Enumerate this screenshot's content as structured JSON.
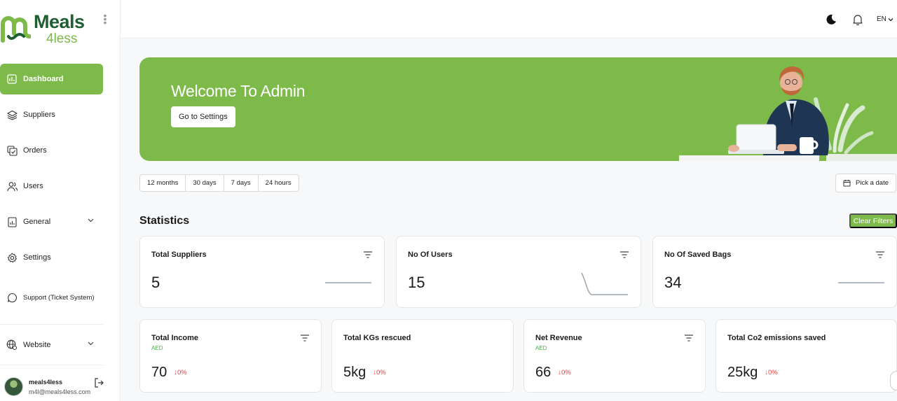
{
  "brand": {
    "line1": "Meals",
    "line2": "4less"
  },
  "sidebar": {
    "items": [
      {
        "label": "Dashboard",
        "icon": "dashboard-icon",
        "active": true
      },
      {
        "label": "Suppliers",
        "icon": "layers-icon"
      },
      {
        "label": "Orders",
        "icon": "orders-icon"
      },
      {
        "label": "Users",
        "icon": "users-icon"
      },
      {
        "label": "General",
        "icon": "report-icon"
      },
      {
        "label": "Settings",
        "icon": "gear-icon"
      },
      {
        "label": "Support (Ticket System)",
        "icon": "chat-icon"
      },
      {
        "label": "Website",
        "icon": "globe-icon"
      }
    ],
    "user": {
      "name": "meals4less",
      "email": "m4l@meals4less.com"
    }
  },
  "topbar": {
    "language": "EN"
  },
  "banner": {
    "title": "Welcome To Admin",
    "button": "Go to Settings"
  },
  "filters": {
    "ranges": [
      "12 months",
      "30 days",
      "7 days",
      "24 hours"
    ],
    "pick_date": "Pick a date"
  },
  "statistics": {
    "title": "Statistics",
    "clear_filters": "Clear Filters",
    "top_cards": [
      {
        "title": "Total Suppliers",
        "value": "5"
      },
      {
        "title": "No Of Users",
        "value": "15"
      },
      {
        "title": "No Of Saved Bags",
        "value": "34"
      }
    ],
    "bottom_cards": [
      {
        "title": "Total Income",
        "sub": "AED",
        "value": "70",
        "delta": "↓0%"
      },
      {
        "title": "Total KGs rescued",
        "sub": "",
        "value": "5kg",
        "delta": "↓0%"
      },
      {
        "title": "Net Revenue",
        "sub": "AED",
        "value": "66",
        "delta": "↓0%"
      },
      {
        "title": "Total Co2 emissions saved",
        "sub": "",
        "value": "25kg",
        "delta": "↓0%"
      }
    ]
  },
  "colors": {
    "accent": "#7dba4a",
    "brand_dark": "#1f5e32",
    "negative": "#e03a3a",
    "positive": "#4cb04a"
  }
}
